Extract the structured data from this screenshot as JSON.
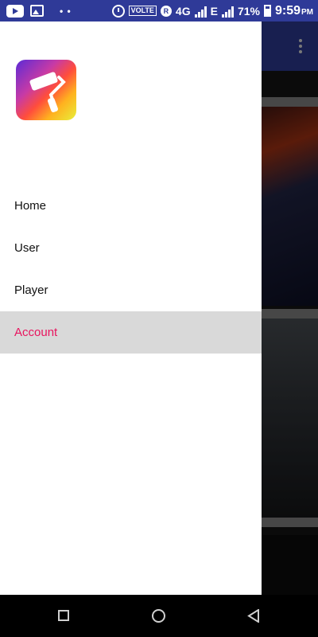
{
  "status_bar": {
    "volte_label": "VOLTE",
    "roaming_label": "R",
    "network_label": "4G",
    "network2_label": "E",
    "battery_percent": "71%",
    "time": "9:59",
    "ampm": "PM"
  },
  "drawer": {
    "logo_icon": "paint-roller-icon",
    "items": [
      {
        "label": "Home",
        "active": false
      },
      {
        "label": "User",
        "active": false
      },
      {
        "label": "Player",
        "active": false
      },
      {
        "label": "Account",
        "active": true
      }
    ],
    "accent_color": "#e8145e"
  },
  "colors": {
    "toolbar": "#25317c",
    "status_bar": "#2f3a98"
  },
  "system_nav": {
    "recents_icon": "square-icon",
    "home_icon": "circle-icon",
    "back_icon": "triangle-back-icon"
  }
}
